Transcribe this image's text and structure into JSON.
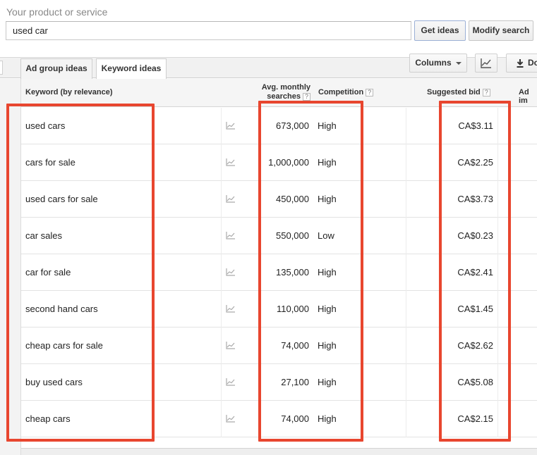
{
  "search": {
    "label": "Your product or service",
    "value": "used car",
    "get_ideas": "Get ideas",
    "modify_search": "Modify search"
  },
  "tabs": [
    {
      "label": "Ad group ideas",
      "active": false
    },
    {
      "label": "Keyword ideas",
      "active": true
    }
  ],
  "toolbar": {
    "columns": "Columns",
    "download_partial": "Do"
  },
  "table": {
    "headers": {
      "keyword": "Keyword (by relevance)",
      "avg_line1": "Avg. monthly",
      "avg_line2": "searches",
      "competition": "Competition",
      "suggested_bid": "Suggested bid",
      "ad_impr_partial": "Ad im"
    },
    "help_glyph": "?",
    "rows": [
      {
        "keyword": "used cars",
        "avg": "673,000",
        "competition": "High",
        "bid": "CA$3.11"
      },
      {
        "keyword": "cars for sale",
        "avg": "1,000,000",
        "competition": "High",
        "bid": "CA$2.25"
      },
      {
        "keyword": "used cars for sale",
        "avg": "450,000",
        "competition": "High",
        "bid": "CA$3.73"
      },
      {
        "keyword": "car sales",
        "avg": "550,000",
        "competition": "Low",
        "bid": "CA$0.23"
      },
      {
        "keyword": "car for sale",
        "avg": "135,000",
        "competition": "High",
        "bid": "CA$2.41"
      },
      {
        "keyword": "second hand cars",
        "avg": "110,000",
        "competition": "High",
        "bid": "CA$1.45"
      },
      {
        "keyword": "cheap cars for sale",
        "avg": "74,000",
        "competition": "High",
        "bid": "CA$2.62"
      },
      {
        "keyword": "buy used cars",
        "avg": "27,100",
        "competition": "High",
        "bid": "CA$5.08"
      },
      {
        "keyword": "cheap cars",
        "avg": "74,000",
        "competition": "High",
        "bid": "CA$2.15"
      }
    ]
  },
  "colors": {
    "highlight": "#e8462f",
    "header_bg": "#f5f5f5"
  },
  "icons": {
    "trend": "trend-chart-icon",
    "chart": "chart-icon",
    "download": "download-icon",
    "dropdown": "chevron-down-icon",
    "help": "help-icon"
  }
}
